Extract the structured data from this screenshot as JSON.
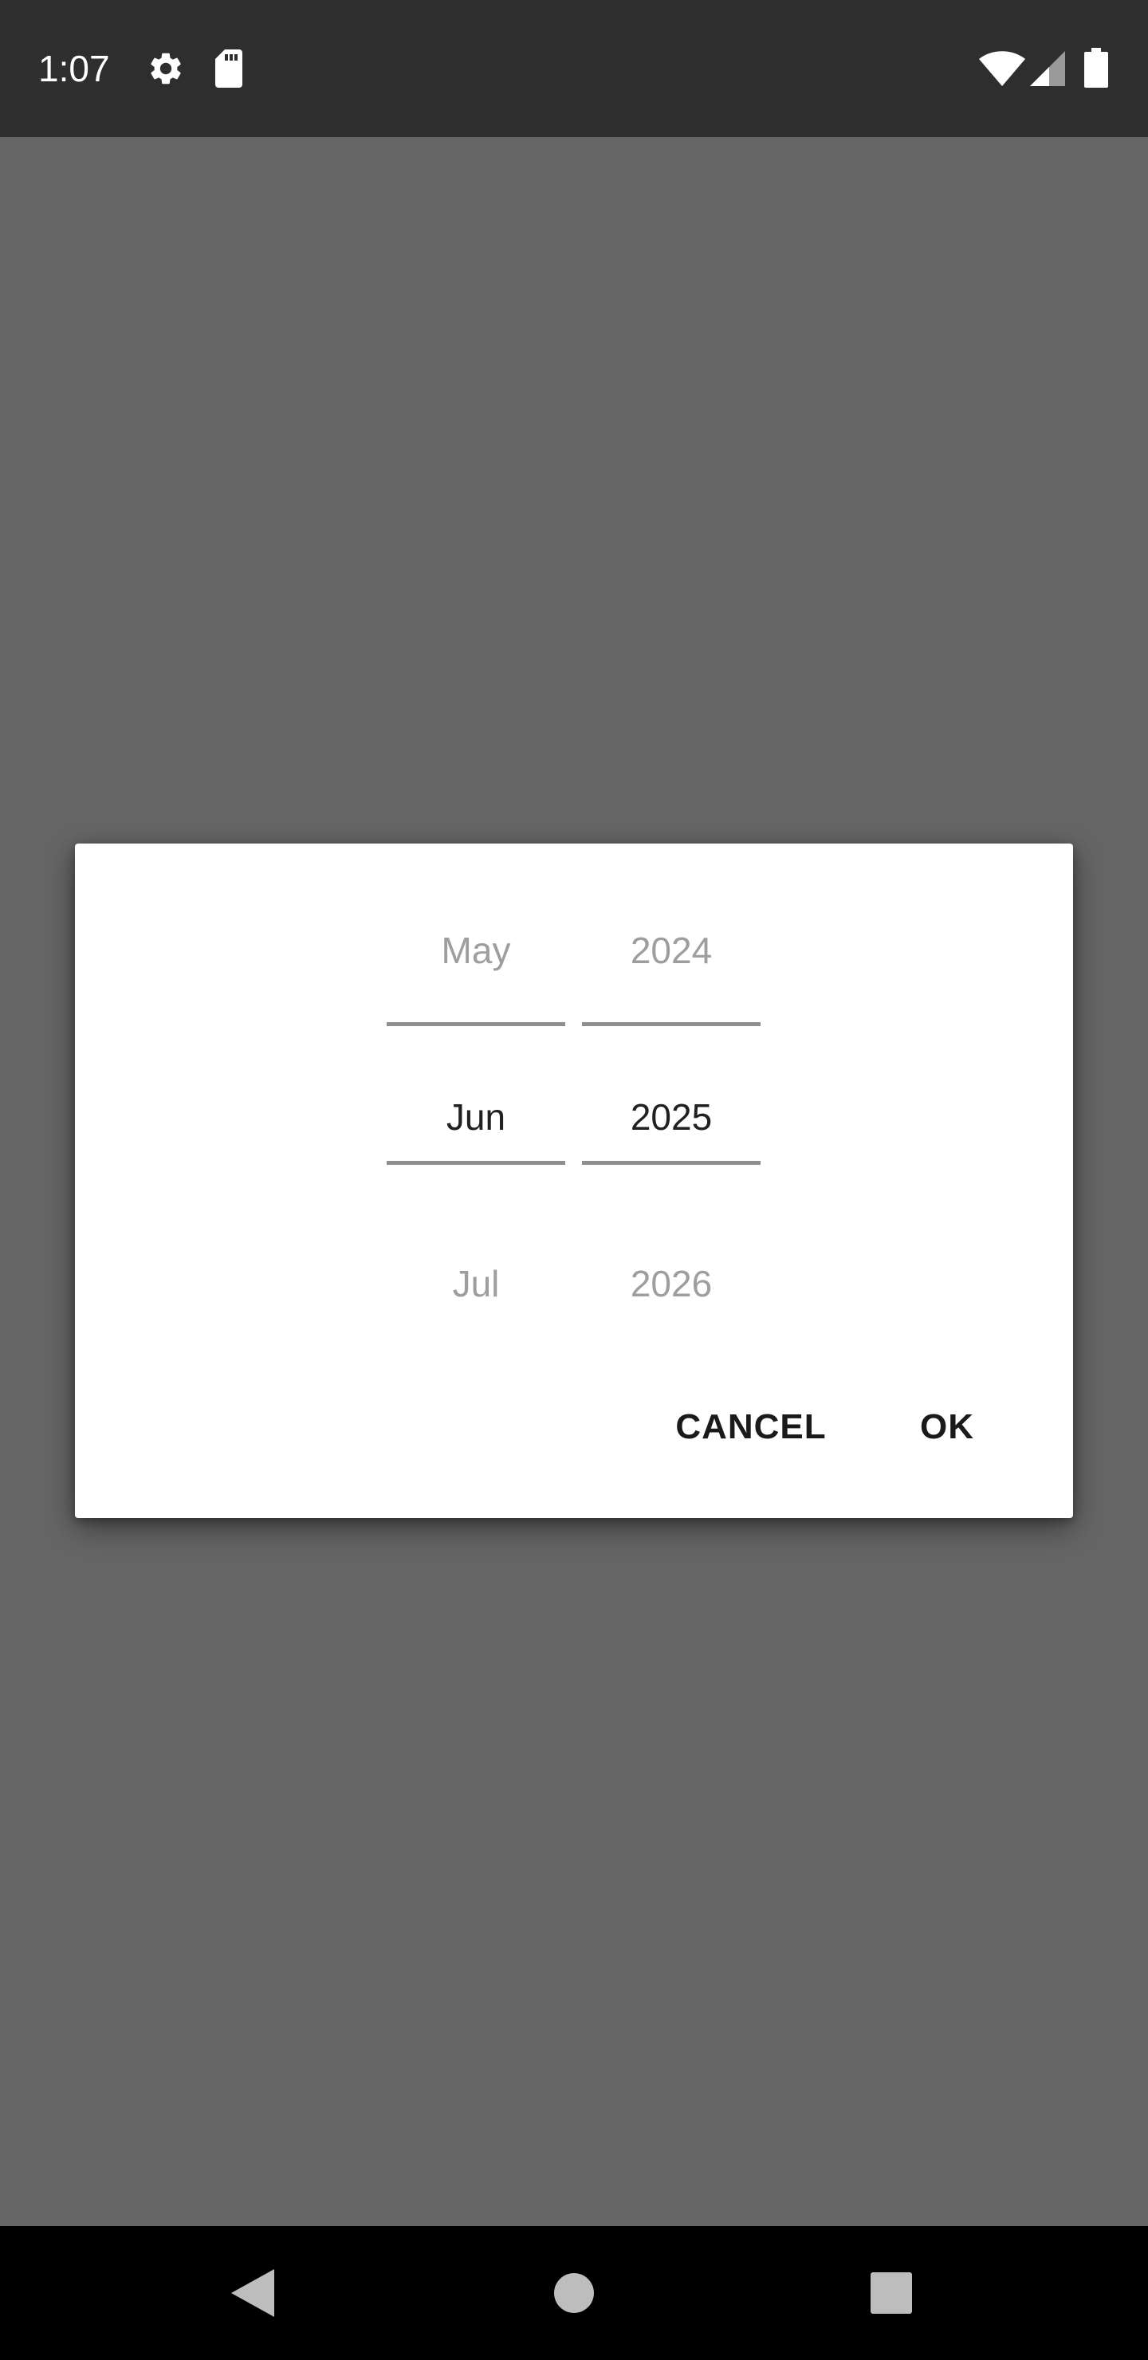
{
  "status_bar": {
    "time": "1:07",
    "icons": [
      "gear-icon",
      "sd-card-icon",
      "wifi-icon",
      "signal-icon",
      "battery-icon"
    ]
  },
  "date_picker": {
    "month": {
      "previous": "May",
      "selected": "Jun",
      "next": "Jul"
    },
    "year": {
      "previous": "2024",
      "selected": "2025",
      "next": "2026"
    },
    "buttons": {
      "cancel": "CANCEL",
      "ok": "OK"
    }
  },
  "nav_bar": {
    "icons": [
      "back-icon",
      "home-icon",
      "recents-icon"
    ]
  },
  "colors": {
    "scrim": "#666666",
    "status_bar": "#2e2e2e",
    "dialog": "#ffffff",
    "selected_text": "#212121",
    "faded_text": "#9e9e9e",
    "divider": "#8f8f8f"
  }
}
